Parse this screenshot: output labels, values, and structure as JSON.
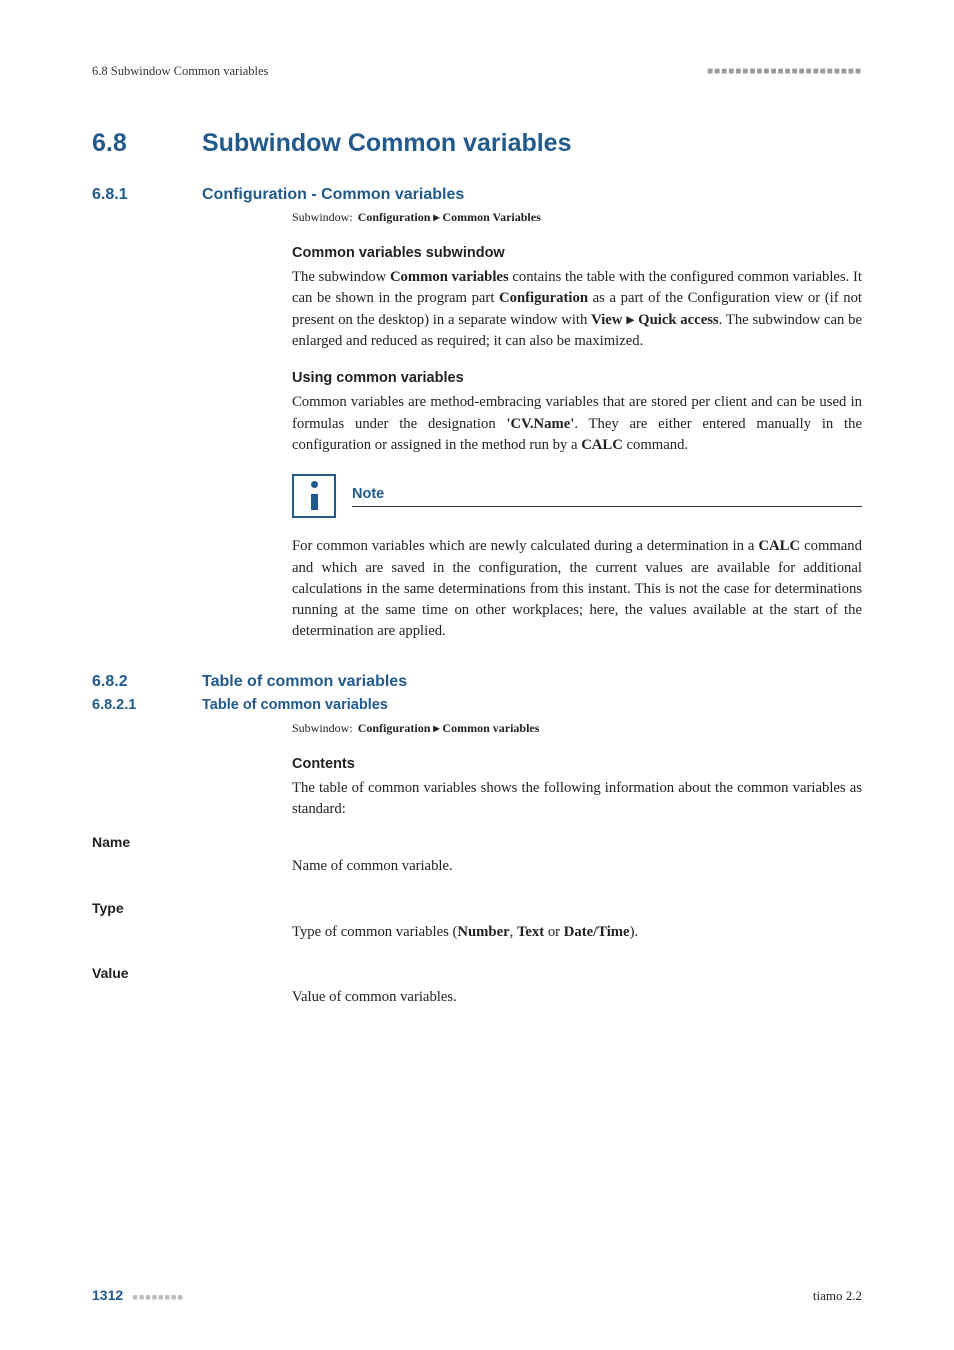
{
  "running_head": {
    "left": "6.8 Subwindow Common variables",
    "dots": "■■■■■■■■■■■■■■■■■■■■■■"
  },
  "section_6_8": {
    "num": "6.8",
    "title": "Subwindow Common variables"
  },
  "section_6_8_1": {
    "num": "6.8.1",
    "title": "Configuration - Common variables",
    "subwindow_label": "Subwindow:",
    "subwindow_path_1": "Configuration",
    "subwindow_arrow": "▸",
    "subwindow_path_2": "Common Variables",
    "sub1_head": "Common variables subwindow",
    "sub1_p_a": "The subwindow ",
    "sub1_p_b": "Common variables",
    "sub1_p_c": " contains the table with the configured common variables. It can be shown in the program part ",
    "sub1_p_d": "Configuration",
    "sub1_p_e": " as a part of the Configuration view or (if not present on the desktop) in a separate window with ",
    "sub1_p_f": "View",
    "sub1_p_g": " ▸ ",
    "sub1_p_h": "Quick access",
    "sub1_p_i": ". The subwindow can be enlarged and reduced as required; it can also be maximized.",
    "sub2_head": "Using common variables",
    "sub2_p_a": "Common variables are method-embracing variables that are stored per client and can be used in formulas under the designation ",
    "sub2_p_b": "'CV.Name'",
    "sub2_p_c": ". They are either entered manually in the configuration or assigned in the method run by a ",
    "sub2_p_d": "CALC",
    "sub2_p_e": " command.",
    "note_label": "Note",
    "note_p_a": "For common variables which are newly calculated during a determination in a ",
    "note_p_b": "CALC",
    "note_p_c": " command and which are saved in the configuration, the current values are available for additional calculations in the same determinations from this instant. This is not the case for determinations running at the same time on other workplaces; here, the values available at the start of the determination are applied."
  },
  "section_6_8_2": {
    "num": "6.8.2",
    "title": "Table of common variables"
  },
  "section_6_8_2_1": {
    "num": "6.8.2.1",
    "title": "Table of common variables",
    "subwindow_label": "Subwindow:",
    "subwindow_path_1": "Configuration",
    "subwindow_arrow": "▸",
    "subwindow_path_2": "Common variables",
    "contents_head": "Contents",
    "contents_p": "The table of common variables shows the following information about the common variables as standard:",
    "defs": {
      "name_label": "Name",
      "name_body": "Name of common variable.",
      "type_label": "Type",
      "type_body_a": "Type of common variables (",
      "type_body_b": "Number",
      "type_body_c": ", ",
      "type_body_d": "Text",
      "type_body_e": " or ",
      "type_body_f": "Date/Time",
      "type_body_g": ").",
      "value_label": "Value",
      "value_body": "Value of common variables."
    }
  },
  "footer": {
    "page": "1312",
    "dots": "■■■■■■■■",
    "right": "tiamo 2.2"
  }
}
